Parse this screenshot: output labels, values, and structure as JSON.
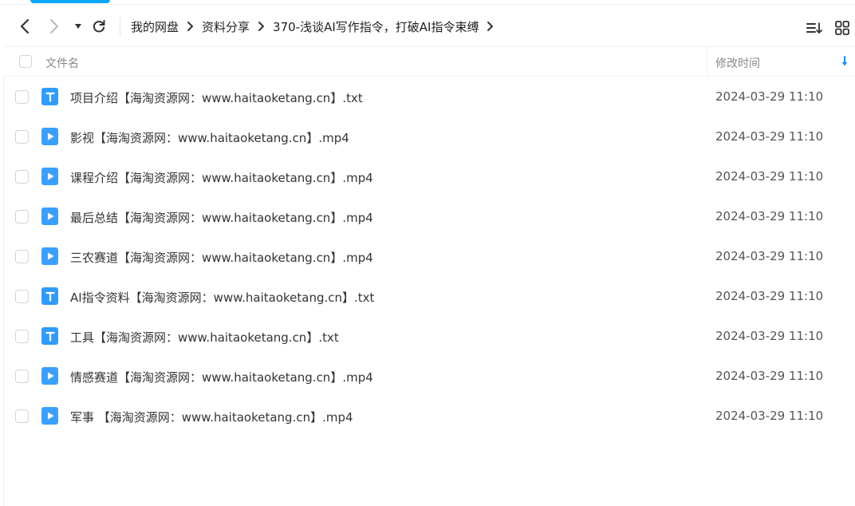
{
  "colors": {
    "accent": "#06a7ff",
    "file_icon_blue": "#2f9cff",
    "text": "#333333",
    "muted": "#888888"
  },
  "toolbar": {
    "back_icon": "chevron-left-icon",
    "forward_icon": "chevron-right-icon",
    "history_icon": "caret-down-icon",
    "refresh_icon": "refresh-icon",
    "sort_icon": "sort-list-icon",
    "grid_icon": "grid-view-icon"
  },
  "breadcrumb": {
    "items": [
      "我的网盘",
      "资料分享",
      "370-浅谈AI写作指令，打破AI指令束缚"
    ]
  },
  "header": {
    "name_label": "文件名",
    "time_label": "修改时间",
    "sort_direction": "descending"
  },
  "files": [
    {
      "name": "项目介绍【海淘资源网：www.haitaoketang.cn】.txt",
      "type": "txt",
      "modified": "2024-03-29 11:10"
    },
    {
      "name": "影视【海淘资源网：www.haitaoketang.cn】.mp4",
      "type": "mp4",
      "modified": "2024-03-29 11:10"
    },
    {
      "name": "课程介绍【海淘资源网：www.haitaoketang.cn】.mp4",
      "type": "mp4",
      "modified": "2024-03-29 11:10"
    },
    {
      "name": "最后总结【海淘资源网：www.haitaoketang.cn】.mp4",
      "type": "mp4",
      "modified": "2024-03-29 11:10"
    },
    {
      "name": "三农赛道【海淘资源网：www.haitaoketang.cn】.mp4",
      "type": "mp4",
      "modified": "2024-03-29 11:10"
    },
    {
      "name": "AI指令资料【海淘资源网：www.haitaoketang.cn】.txt",
      "type": "txt",
      "modified": "2024-03-29 11:10"
    },
    {
      "name": "工具【海淘资源网：www.haitaoketang.cn】.txt",
      "type": "txt",
      "modified": "2024-03-29 11:10"
    },
    {
      "name": "情感赛道【海淘资源网：www.haitaoketang.cn】.mp4",
      "type": "mp4",
      "modified": "2024-03-29 11:10"
    },
    {
      "name": "军事 【海淘资源网：www.haitaoketang.cn】.mp4",
      "type": "mp4",
      "modified": "2024-03-29 11:10"
    }
  ]
}
